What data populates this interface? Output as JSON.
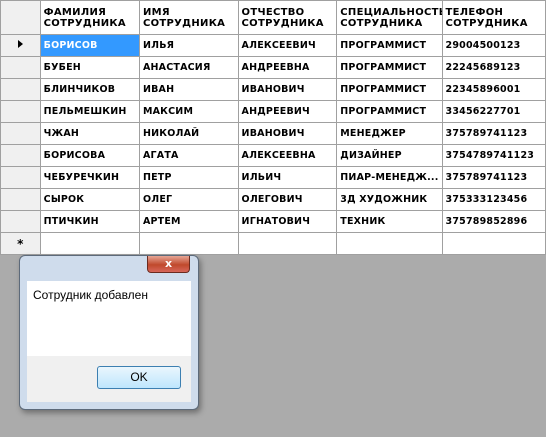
{
  "grid": {
    "columns": [
      "ФАМИЛИЯ СОТРУДНИКА",
      "ИМЯ СОТРУДНИКА",
      "ОТЧЕСТВО СОТРУДНИКА",
      "СПЕЦИАЛЬНОСТЬ СОТРУДНИКА",
      "ТЕЛЕФОН СОТРУДНИКА"
    ],
    "rows": [
      [
        "БОРИСОВ",
        "ИЛЬЯ",
        "АЛЕКСЕЕВИЧ",
        "ПРОГРАММИСТ",
        "29004500123"
      ],
      [
        "БУБЕН",
        "АНАСТАСИЯ",
        "АНДРЕЕВНА",
        "ПРОГРАММИСТ",
        "22245689123"
      ],
      [
        "БЛИНЧИКОВ",
        "ИВАН",
        "ИВАНОВИЧ",
        "ПРОГРАММИСТ",
        "22345896001"
      ],
      [
        "ПЕЛЬМЕШКИН",
        "МАКСИМ",
        "АНДРЕЕВИЧ",
        "ПРОГРАММИСТ",
        "33456227701"
      ],
      [
        "ЧЖАН",
        "НИКОЛАЙ",
        "ИВАНОВИЧ",
        "МЕНЕДЖЕР",
        "375789741123"
      ],
      [
        "БОРИСОВА",
        "АГАТА",
        "АЛЕКСЕЕВНА",
        "ДИЗАЙНЕР",
        "3754789741123"
      ],
      [
        "ЧЕБУРЕЧКИН",
        "ПЕТР",
        "ИЛЬИЧ",
        "ПИАР-МЕНЕДЖ...",
        "375789741123"
      ],
      [
        "СЫРОК",
        "ОЛЕГ",
        "ОЛЕГОВИЧ",
        "3Д ХУДОЖНИК",
        "375333123456"
      ],
      [
        "ПТИЧКИН",
        "АРТЕМ",
        "ИГНАТОВИЧ",
        "ТЕХНИК",
        "375789852896"
      ]
    ],
    "new_row_marker": "*",
    "selected_row": 0,
    "selected_col": 0
  },
  "dialog": {
    "close_label": "x",
    "message": "Сотрудник добавлен",
    "ok_label": "OK"
  },
  "colors": {
    "selection": "#3399ff",
    "background": "#ababab"
  }
}
